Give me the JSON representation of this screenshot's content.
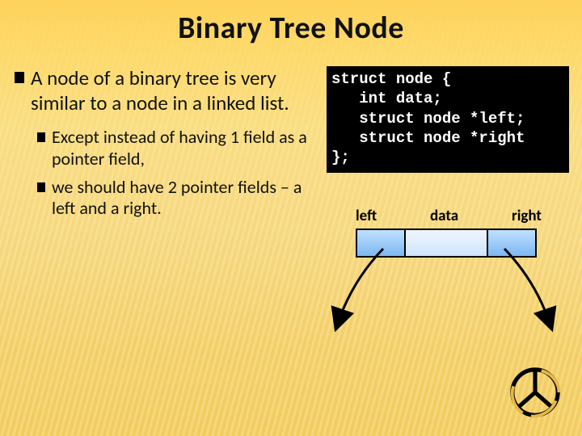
{
  "title": "Binary Tree Node",
  "bullets": {
    "main": "A node of a binary tree is very similar to a node in a linked list.",
    "sub1": "Except instead of having 1 field as a pointer field,",
    "sub2": "we should have 2 pointer fields – a left and a right."
  },
  "code": "struct node {\n   int data;\n   struct node *left;\n   struct node *right\n};",
  "diagram": {
    "left_label": "left",
    "data_label": "data",
    "right_label": "right"
  }
}
